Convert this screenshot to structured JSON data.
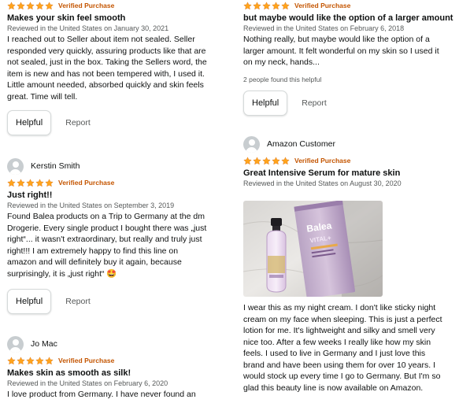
{
  "colors": {
    "star": "#ffa41c",
    "verified": "#c45500",
    "text": "#0f1111",
    "meta": "#565959"
  },
  "left_column": {
    "review1": {
      "verified": "Verified Purchase",
      "title": "Makes your skin feel smooth",
      "meta": "Reviewed in the United States on January 30, 2021",
      "body": [
        "I reached out to Seller about item not sealed. Seller",
        "responded very quickly, assuring products like that are",
        "not sealed, just in the box. Taking the Sellers word, the",
        "item is new and has not been tempered with, I used it.",
        "Little amount needed, absorbed quickly and skin feels",
        "great. Time will tell."
      ],
      "helpful": "Helpful",
      "report": "Report"
    },
    "review2": {
      "name": "Kerstin Smith",
      "verified": "Verified Purchase",
      "title": "Just right!!",
      "meta": "Reviewed in the United States on September 3, 2019",
      "body": [
        "Found Balea products on a Trip to Germany at the dm",
        "Drogerie. Every single product I bought there was „just",
        "right“... it wasn't extraordinary, but really and truly just",
        "right!!! I am extremely happy to find this line on",
        "amazon and will definitely buy it again, because",
        "surprisingly, it is „just right“ 🤩"
      ],
      "helpful": "Helpful",
      "report": "Report"
    },
    "review3": {
      "name": "Jo Mac",
      "verified": "Verified Purchase",
      "title": "Makes skin as smooth as silk!",
      "meta": "Reviewed in the United States on February 6, 2020",
      "body": [
        "I love product from Germany. I have never found an"
      ]
    }
  },
  "right_column": {
    "review1": {
      "verified": "Verified Purchase",
      "title": "but maybe would like the option of a larger amount",
      "meta": "Reviewed in the United States on February 6, 2018",
      "body": [
        "Nothing really, but maybe would like the option of a",
        "larger amount. It felt wonderful on my skin so I used it",
        "on my neck, hands..."
      ],
      "found": "2 people found this helpful",
      "helpful": "Helpful",
      "report": "Report"
    },
    "review2": {
      "name": "Amazon Customer",
      "verified": "Verified Purchase",
      "title": "Great Intensive Serum for mature skin",
      "meta": "Reviewed in the United States on August 30, 2020",
      "photo_brand": "Balea",
      "photo_line": "VITAL+",
      "body": [
        "I wear this as my night cream. I don't like sticky night",
        "cream on my face when sleeping. This is just a perfect",
        "lotion for me. It's lightweight and silky and smell very",
        "nice too. After a few weeks I really like how my skin",
        "feels. I used to live in Germany and I just love this",
        "brand and have been using them for over 10 years. I",
        "would stock up every time I go to Germany. But I'm so",
        "glad this beauty line is now available on Amazon."
      ]
    }
  }
}
